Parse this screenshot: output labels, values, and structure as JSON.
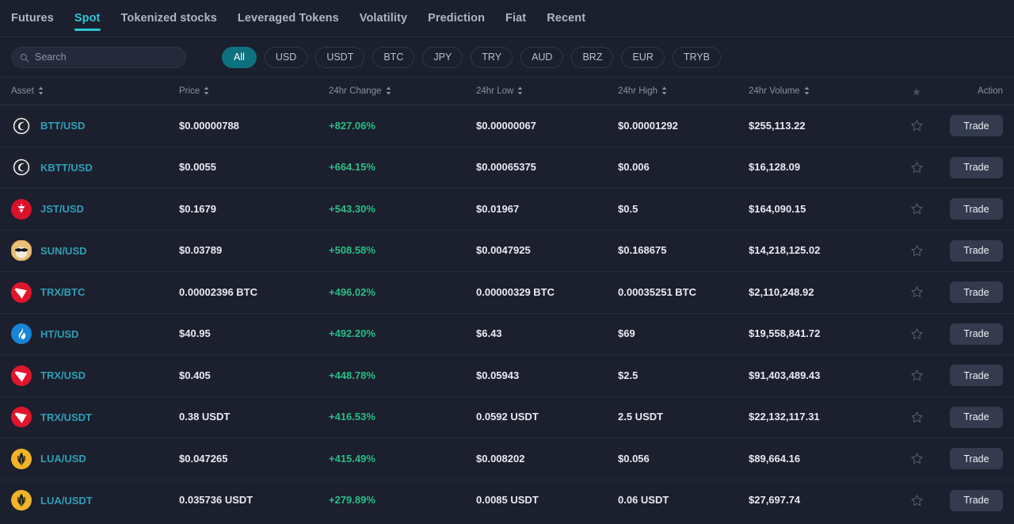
{
  "nav": {
    "tabs": [
      {
        "label": "Futures",
        "active": false
      },
      {
        "label": "Spot",
        "active": true
      },
      {
        "label": "Tokenized stocks",
        "active": false
      },
      {
        "label": "Leveraged Tokens",
        "active": false
      },
      {
        "label": "Volatility",
        "active": false
      },
      {
        "label": "Prediction",
        "active": false
      },
      {
        "label": "Fiat",
        "active": false
      },
      {
        "label": "Recent",
        "active": false
      }
    ]
  },
  "search": {
    "placeholder": "Search",
    "value": "",
    "icon": "search-icon"
  },
  "filters": {
    "selected": "All",
    "options": [
      "All",
      "USD",
      "USDT",
      "BTC",
      "JPY",
      "TRY",
      "AUD",
      "BRZ",
      "EUR",
      "TRYB"
    ]
  },
  "table": {
    "columns": [
      {
        "label": "Asset",
        "sortable": true
      },
      {
        "label": "Price",
        "sortable": true
      },
      {
        "label": "24hr Change",
        "sortable": true
      },
      {
        "label": "24hr Low",
        "sortable": true
      },
      {
        "label": "24hr High",
        "sortable": true
      },
      {
        "label": "24hr Volume",
        "sortable": true
      },
      {
        "label": "",
        "sortable": false,
        "icon": "star-icon"
      },
      {
        "label": "Action",
        "sortable": false
      }
    ],
    "action_label": "Trade",
    "rows": [
      {
        "asset": "BTT/USD",
        "logo": "btt",
        "price": "$0.00000788",
        "change": "+827.06%",
        "low": "$0.00000067",
        "high": "$0.00001292",
        "volume": "$255,113.22",
        "favorited": false
      },
      {
        "asset": "KBTT/USD",
        "logo": "btt",
        "price": "$0.0055",
        "change": "+664.15%",
        "low": "$0.00065375",
        "high": "$0.006",
        "volume": "$16,128.09",
        "favorited": false
      },
      {
        "asset": "JST/USD",
        "logo": "jst",
        "price": "$0.1679",
        "change": "+543.30%",
        "low": "$0.01967",
        "high": "$0.5",
        "volume": "$164,090.15",
        "favorited": false
      },
      {
        "asset": "SUN/USD",
        "logo": "sun",
        "price": "$0.03789",
        "change": "+508.58%",
        "low": "$0.0047925",
        "high": "$0.168675",
        "volume": "$14,218,125.02",
        "favorited": false
      },
      {
        "asset": "TRX/BTC",
        "logo": "trx",
        "price": "0.00002396 BTC",
        "change": "+496.02%",
        "low": "0.00000329 BTC",
        "high": "0.00035251 BTC",
        "volume": "$2,110,248.92",
        "favorited": false
      },
      {
        "asset": "HT/USD",
        "logo": "ht",
        "price": "$40.95",
        "change": "+492.20%",
        "low": "$6.43",
        "high": "$69",
        "volume": "$19,558,841.72",
        "favorited": false
      },
      {
        "asset": "TRX/USD",
        "logo": "trx",
        "price": "$0.405",
        "change": "+448.78%",
        "low": "$0.05943",
        "high": "$2.5",
        "volume": "$91,403,489.43",
        "favorited": false
      },
      {
        "asset": "TRX/USDT",
        "logo": "trx",
        "price": "0.38 USDT",
        "change": "+416.53%",
        "low": "0.0592 USDT",
        "high": "2.5 USDT",
        "volume": "$22,132,117.31",
        "favorited": false
      },
      {
        "asset": "LUA/USD",
        "logo": "lua",
        "price": "$0.047265",
        "change": "+415.49%",
        "low": "$0.008202",
        "high": "$0.056",
        "volume": "$89,664.16",
        "favorited": false
      },
      {
        "asset": "LUA/USDT",
        "logo": "lua",
        "price": "0.035736 USDT",
        "change": "+279.89%",
        "low": "0.0085 USDT",
        "high": "0.06 USDT",
        "volume": "$27,697.74",
        "favorited": false
      }
    ]
  },
  "colors": {
    "background": "#1b1f2e",
    "accent_teal": "#2ec6d6",
    "pill_active": "#0e7180",
    "positive_green": "#2bbd85",
    "asset_link": "#2f9fb5"
  }
}
